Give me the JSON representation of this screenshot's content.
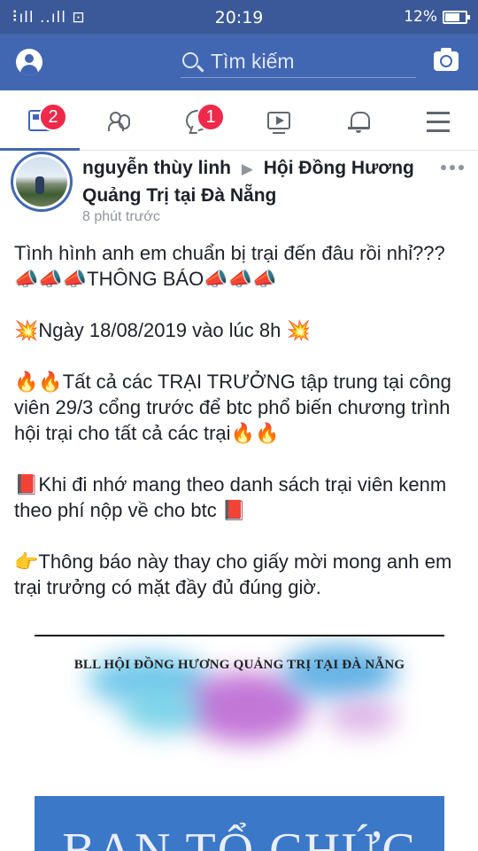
{
  "status_bar": {
    "signal": "ਫ਼▐▐ .▐▐ ₂",
    "time": "20:19",
    "battery": "12%"
  },
  "search": {
    "placeholder": "Tìm kiếm"
  },
  "nav": {
    "tabs": [
      {
        "name": "news-feed",
        "icon": "news-feed-icon",
        "badge": "2",
        "active": true
      },
      {
        "name": "friends",
        "icon": "friends-icon",
        "badge": ""
      },
      {
        "name": "messenger",
        "icon": "messenger-icon",
        "badge": "1"
      },
      {
        "name": "watch",
        "icon": "watch-video-icon",
        "badge": ""
      },
      {
        "name": "notifications",
        "icon": "bell-icon",
        "badge": ""
      },
      {
        "name": "menu",
        "icon": "hamburger-menu-icon",
        "badge": ""
      }
    ]
  },
  "post": {
    "author": "nguyễn thùy linh",
    "group": "Hội Đồng Hương Quảng Trị tại Đà Nẵng",
    "time": "8 phút trước",
    "lines": [
      "Tình hình anh em chuẩn bị trại đến đâu rồi nhỉ???",
      "📣📣📣THÔNG BÁO📣📣📣",
      "",
      "💥Ngày 18/08/2019 vào lúc 8h 💥",
      "",
      "🔥🔥Tất cả các TRẠI TRƯỞNG tập trung tại công viên 29/3 cổng trước để btc phổ biến chương trình hội trại cho tất cả các trại🔥🔥",
      "",
      "📕Khi đi nhớ mang theo danh sách trại viên kenm theo phí nộp về cho btc 📕",
      "",
      "👉Thông báo này thay cho giấy mời mong anh em trại trưởng có mặt đầy đủ đúng giờ."
    ],
    "image": {
      "caption": "BLL HỘI ĐỒNG HƯƠNG QUẢNG TRỊ TẠI ĐÀ NẴNG",
      "banner": "BAN TỔ CHỨC"
    }
  },
  "colors": {
    "header_blue": "#4267b2",
    "status_blue": "#3b5998",
    "badge_red": "#f02849"
  }
}
